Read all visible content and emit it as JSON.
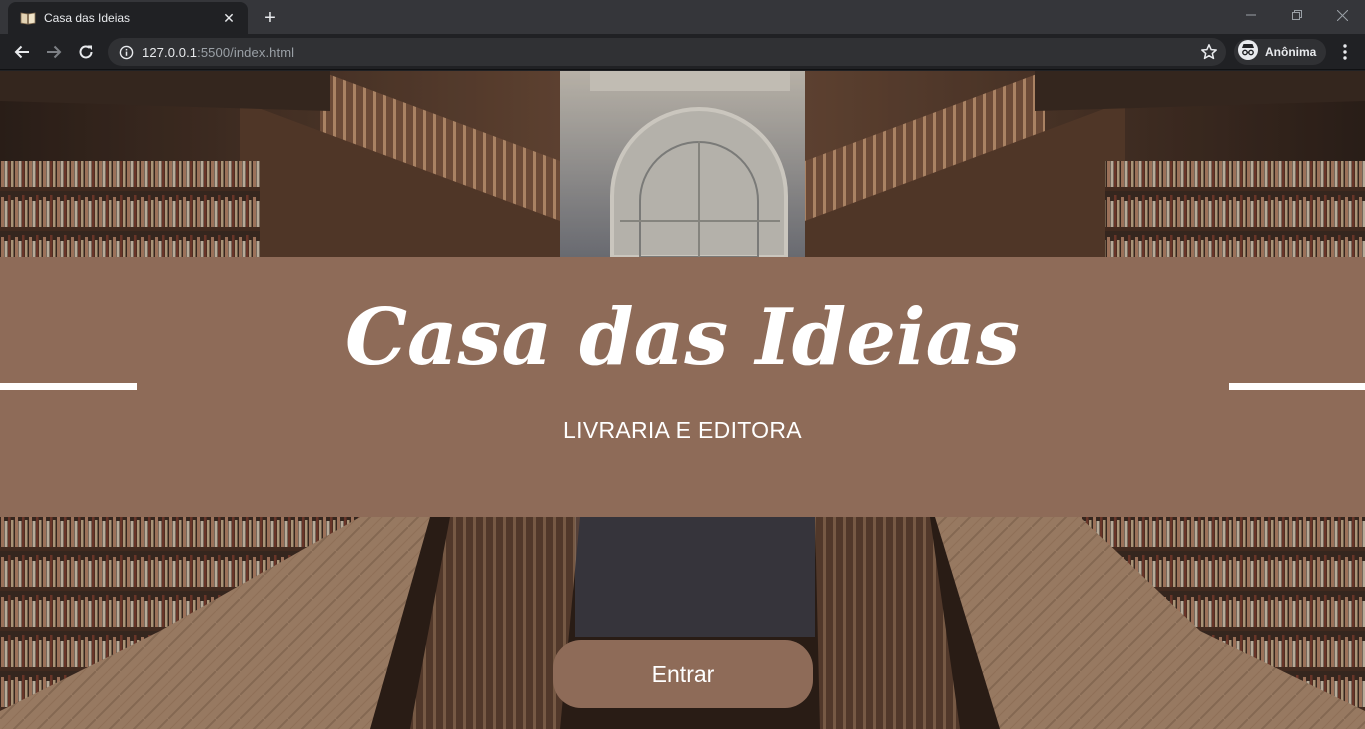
{
  "browser": {
    "tab": {
      "title": "Casa das Ideias",
      "favicon": "book-icon"
    },
    "new_tab_symbol": "+",
    "address": {
      "host": "127.0.0.1",
      "rest": ":5500/index.html"
    },
    "profile_label": "Anônima"
  },
  "page": {
    "title": "Casa das Ideias",
    "subtitle": "LIVRARIA E EDITORA",
    "enter_button": "Entrar",
    "colors": {
      "banner": "#8e6b58",
      "button": "#8e6b58",
      "text": "#ffffff"
    },
    "background_image": "library interior with bookshelves, balconies and arched window"
  }
}
